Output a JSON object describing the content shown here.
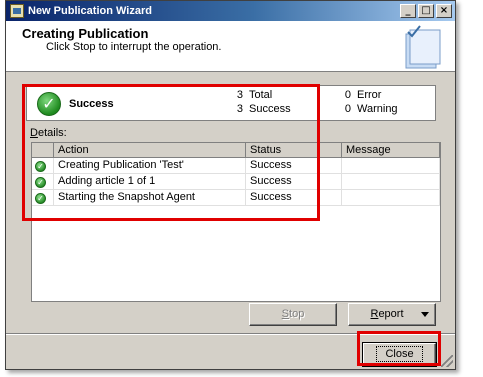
{
  "window": {
    "title": "New Publication Wizard"
  },
  "header": {
    "title": "Creating Publication",
    "subtitle": "Click Stop to interrupt the operation."
  },
  "summary": {
    "status": "Success",
    "total_count": "3",
    "total_label": "Total",
    "success_count": "3",
    "success_label": "Success",
    "error_count": "0",
    "error_label": "Error",
    "warning_count": "0",
    "warning_label": "Warning"
  },
  "details": {
    "label_underlined": "D",
    "label_rest": "etails:",
    "columns": [
      "Action",
      "Status",
      "Message"
    ],
    "rows": [
      {
        "action": "Creating Publication 'Test'",
        "status": "Success",
        "message": ""
      },
      {
        "action": "Adding article 1 of 1",
        "status": "Success",
        "message": ""
      },
      {
        "action": "Starting the Snapshot Agent",
        "status": "Success",
        "message": ""
      }
    ]
  },
  "buttons": {
    "stop_underlined": "S",
    "stop_rest": "top",
    "report_underlined": "R",
    "report_rest": "eport",
    "close": "Close"
  },
  "colors": {
    "annotation": "#e00000",
    "success_icon": "#1e8a1e",
    "title_bar": "#0a246a"
  },
  "icons": {
    "app": "wizard-icon",
    "success": "success-check-icon",
    "row": "check-icon",
    "header_art": "book-check-icon"
  }
}
